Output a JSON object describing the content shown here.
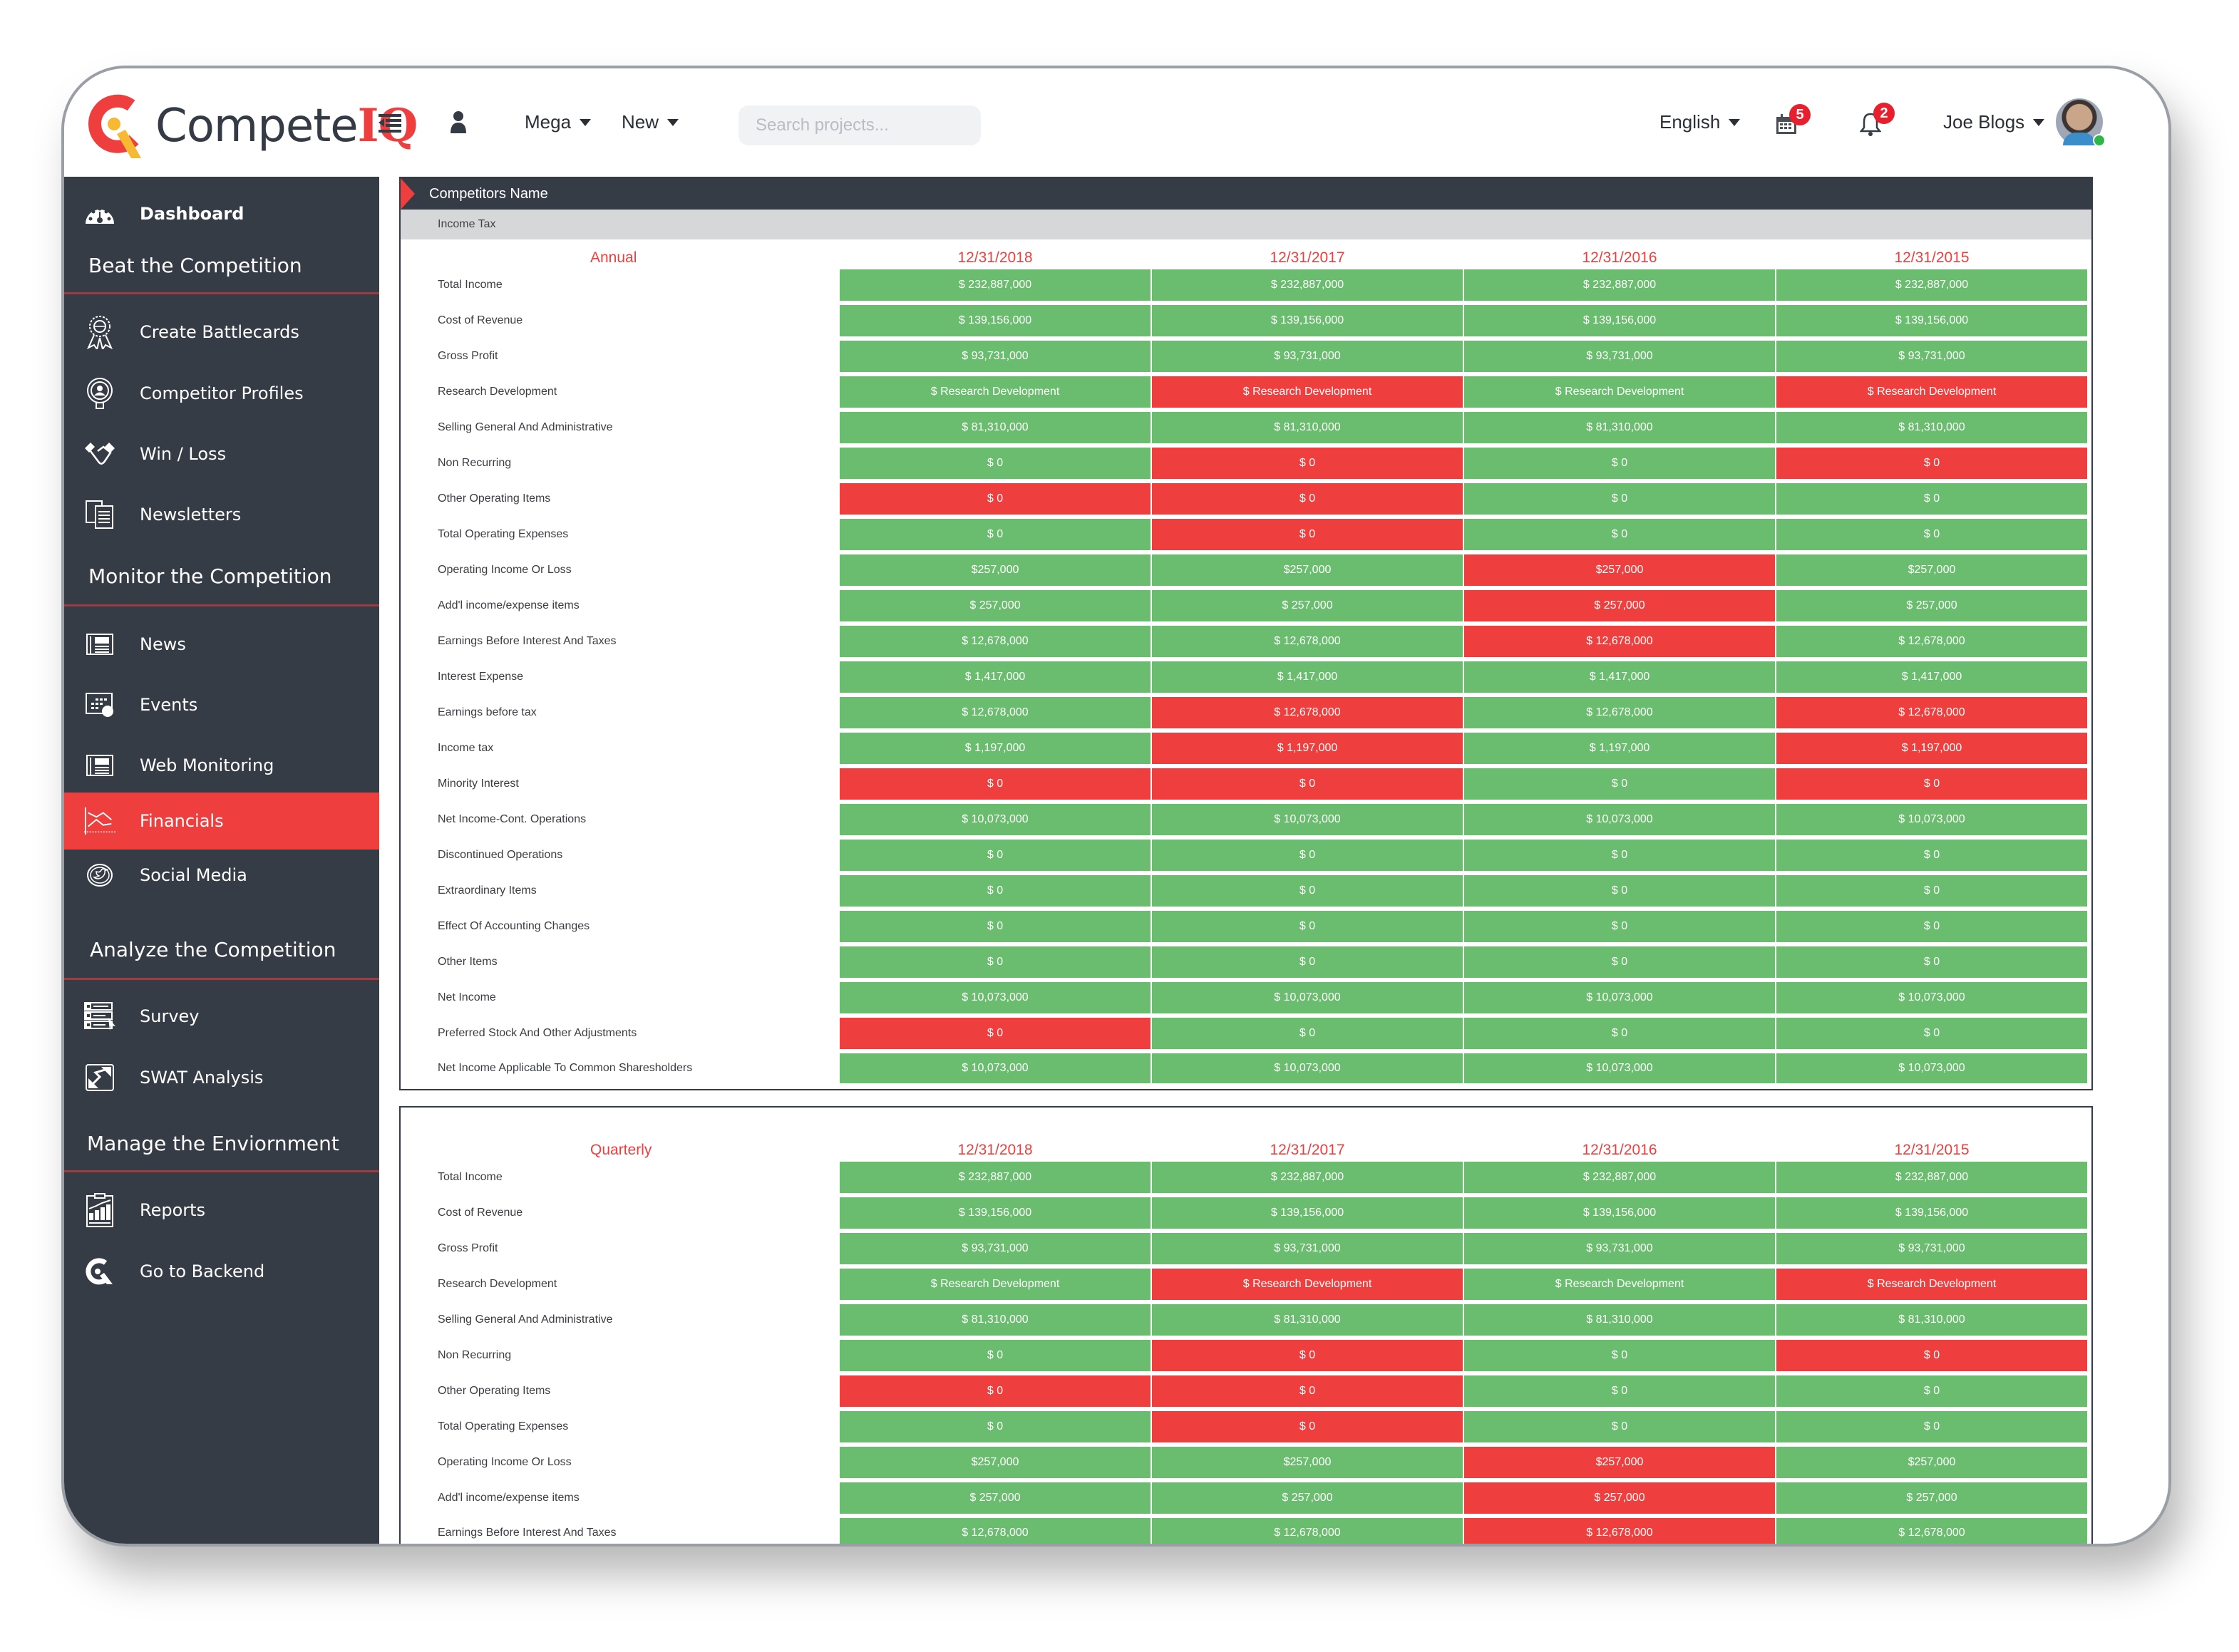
{
  "header": {
    "brand_prefix": "Compete",
    "brand_suffix": "IQ",
    "menus": [
      {
        "label": "Mega"
      },
      {
        "label": "New"
      }
    ],
    "search": {
      "placeholder": "Search projects...",
      "value": ""
    },
    "language": "English",
    "calendar_badge": "5",
    "notification_badge": "2",
    "user_name": "Joe Blogs",
    "user_status": "online"
  },
  "sidebar": {
    "dashboard": "Dashboard",
    "sections": [
      {
        "title": "Beat the Competition",
        "items": [
          {
            "label": "Create Battlecards",
            "icon": "award-ribbon-icon"
          },
          {
            "label": "Competitor Profiles",
            "icon": "profile-badge-icon"
          },
          {
            "label": "Win / Loss",
            "icon": "handshake-icon"
          },
          {
            "label": "Newsletters",
            "icon": "documents-icon"
          }
        ]
      },
      {
        "title": "Monitor the Competition",
        "items": [
          {
            "label": "News",
            "icon": "newspaper-icon"
          },
          {
            "label": "Events",
            "icon": "calendar-event-icon"
          },
          {
            "label": "Web Monitoring",
            "icon": "newspaper-icon"
          },
          {
            "label": "Financials",
            "icon": "chart-trend-icon",
            "active": true
          },
          {
            "label": "Social Media",
            "icon": "twitter-icon"
          }
        ]
      },
      {
        "title": "Analyze the Competition",
        "items": [
          {
            "label": "Survey",
            "icon": "survey-icon"
          },
          {
            "label": "SWAT Analysis",
            "icon": "swot-arrows-icon"
          }
        ]
      },
      {
        "title": "Manage the Enviornment",
        "items": [
          {
            "label": "Reports",
            "icon": "report-clipboard-icon"
          },
          {
            "label": "Go to Backend",
            "icon": "competeiq-logo-icon"
          }
        ]
      }
    ]
  },
  "colors": {
    "accent": "#ef3e3e",
    "positive": "#6abc6e",
    "negative": "#ef3e3e",
    "sidebar_bg": "#363c46"
  },
  "annual": {
    "card_title": "Competitors Name",
    "card_subtitle": "Income Tax",
    "period_label": "Annual",
    "columns": [
      "12/31/2018",
      "12/31/2017",
      "12/31/2016",
      "12/31/2015"
    ],
    "rows": [
      {
        "label": "Total Income",
        "values": [
          "$ 232,887,000",
          "$ 232,887,000",
          "$ 232,887,000",
          "$ 232,887,000"
        ],
        "status": [
          "g",
          "g",
          "g",
          "g"
        ]
      },
      {
        "label": "Cost of Revenue",
        "values": [
          "$ 139,156,000",
          "$ 139,156,000",
          "$ 139,156,000",
          "$ 139,156,000"
        ],
        "status": [
          "g",
          "g",
          "g",
          "g"
        ]
      },
      {
        "label": "Gross Profit",
        "values": [
          "$ 93,731,000",
          "$ 93,731,000",
          "$ 93,731,000",
          "$ 93,731,000"
        ],
        "status": [
          "g",
          "g",
          "g",
          "g"
        ]
      },
      {
        "label": "Research Development",
        "values": [
          "$ Research Development",
          "$ Research Development",
          "$ Research Development",
          "$ Research Development"
        ],
        "status": [
          "g",
          "r",
          "g",
          "r"
        ]
      },
      {
        "label": "Selling General And Administrative",
        "values": [
          "$ 81,310,000",
          "$ 81,310,000",
          "$ 81,310,000",
          "$ 81,310,000"
        ],
        "status": [
          "g",
          "g",
          "g",
          "g"
        ]
      },
      {
        "label": "Non Recurring",
        "values": [
          "$ 0",
          "$ 0",
          "$ 0",
          "$ 0"
        ],
        "status": [
          "g",
          "r",
          "g",
          "r"
        ]
      },
      {
        "label": "Other Operating Items",
        "values": [
          "$ 0",
          "$ 0",
          "$ 0",
          "$ 0"
        ],
        "status": [
          "r",
          "r",
          "g",
          "g"
        ]
      },
      {
        "label": "Total Operating Expenses",
        "values": [
          "$ 0",
          "$ 0",
          "$ 0",
          "$ 0"
        ],
        "status": [
          "g",
          "r",
          "g",
          "g"
        ]
      },
      {
        "label": "Operating Income Or Loss",
        "values": [
          "$257,000",
          "$257,000",
          "$257,000",
          "$257,000"
        ],
        "status": [
          "g",
          "g",
          "r",
          "g"
        ]
      },
      {
        "label": "Add'l income/expense items",
        "values": [
          "$ 257,000",
          "$ 257,000",
          "$ 257,000",
          "$ 257,000"
        ],
        "status": [
          "g",
          "g",
          "r",
          "g"
        ]
      },
      {
        "label": "Earnings Before Interest And Taxes",
        "values": [
          "$ 12,678,000",
          "$ 12,678,000",
          "$ 12,678,000",
          "$ 12,678,000"
        ],
        "status": [
          "g",
          "g",
          "r",
          "g"
        ]
      },
      {
        "label": "Interest Expense",
        "values": [
          "$ 1,417,000",
          "$ 1,417,000",
          "$ 1,417,000",
          "$ 1,417,000"
        ],
        "status": [
          "g",
          "g",
          "g",
          "g"
        ]
      },
      {
        "label": "Earnings before tax",
        "values": [
          "$ 12,678,000",
          "$ 12,678,000",
          "$ 12,678,000",
          "$ 12,678,000"
        ],
        "status": [
          "g",
          "r",
          "g",
          "r"
        ]
      },
      {
        "label": "Income tax",
        "values": [
          "$ 1,197,000",
          "$ 1,197,000",
          "$ 1,197,000",
          "$ 1,197,000"
        ],
        "status": [
          "g",
          "r",
          "g",
          "r"
        ]
      },
      {
        "label": "Minority Interest",
        "values": [
          "$ 0",
          "$ 0",
          "$ 0",
          "$ 0"
        ],
        "status": [
          "r",
          "r",
          "g",
          "r"
        ]
      },
      {
        "label": "Net Income-Cont. Operations",
        "values": [
          "$ 10,073,000",
          "$ 10,073,000",
          "$ 10,073,000",
          "$ 10,073,000"
        ],
        "status": [
          "g",
          "g",
          "g",
          "g"
        ]
      },
      {
        "label": "Discontinued Operations",
        "values": [
          "$ 0",
          "$ 0",
          "$ 0",
          "$ 0"
        ],
        "status": [
          "g",
          "g",
          "g",
          "g"
        ]
      },
      {
        "label": "Extraordinary Items",
        "values": [
          "$ 0",
          "$ 0",
          "$ 0",
          "$ 0"
        ],
        "status": [
          "g",
          "g",
          "g",
          "g"
        ]
      },
      {
        "label": "Effect Of Accounting Changes",
        "values": [
          "$ 0",
          "$ 0",
          "$ 0",
          "$ 0"
        ],
        "status": [
          "g",
          "g",
          "g",
          "g"
        ]
      },
      {
        "label": "Other Items",
        "values": [
          "$ 0",
          "$ 0",
          "$ 0",
          "$ 0"
        ],
        "status": [
          "g",
          "g",
          "g",
          "g"
        ]
      },
      {
        "label": "Net Income",
        "values": [
          "$ 10,073,000",
          "$ 10,073,000",
          "$ 10,073,000",
          "$ 10,073,000"
        ],
        "status": [
          "g",
          "g",
          "g",
          "g"
        ]
      },
      {
        "label": "Preferred Stock And Other Adjustments",
        "values": [
          "$ 0",
          "$ 0",
          "$ 0",
          "$ 0"
        ],
        "status": [
          "r",
          "g",
          "g",
          "g"
        ]
      },
      {
        "label": "Net Income Applicable To Common Sharesholders",
        "values": [
          "$ 10,073,000",
          "$ 10,073,000",
          "$ 10,073,000",
          "$ 10,073,000"
        ],
        "status": [
          "g",
          "g",
          "g",
          "g"
        ]
      }
    ]
  },
  "quarterly": {
    "period_label": "Quarterly",
    "columns": [
      "12/31/2018",
      "12/31/2017",
      "12/31/2016",
      "12/31/2015"
    ],
    "rows": [
      {
        "label": "Total Income",
        "values": [
          "$ 232,887,000",
          "$ 232,887,000",
          "$ 232,887,000",
          "$ 232,887,000"
        ],
        "status": [
          "g",
          "g",
          "g",
          "g"
        ]
      },
      {
        "label": "Cost of Revenue",
        "values": [
          "$ 139,156,000",
          "$ 139,156,000",
          "$ 139,156,000",
          "$ 139,156,000"
        ],
        "status": [
          "g",
          "g",
          "g",
          "g"
        ]
      },
      {
        "label": "Gross Profit",
        "values": [
          "$ 93,731,000",
          "$ 93,731,000",
          "$ 93,731,000",
          "$ 93,731,000"
        ],
        "status": [
          "g",
          "g",
          "g",
          "g"
        ]
      },
      {
        "label": "Research Development",
        "values": [
          "$ Research Development",
          "$ Research Development",
          "$ Research Development",
          "$ Research Development"
        ],
        "status": [
          "g",
          "r",
          "g",
          "r"
        ]
      },
      {
        "label": "Selling General And Administrative",
        "values": [
          "$ 81,310,000",
          "$ 81,310,000",
          "$ 81,310,000",
          "$ 81,310,000"
        ],
        "status": [
          "g",
          "g",
          "g",
          "g"
        ]
      },
      {
        "label": "Non Recurring",
        "values": [
          "$ 0",
          "$ 0",
          "$ 0",
          "$ 0"
        ],
        "status": [
          "g",
          "r",
          "g",
          "r"
        ]
      },
      {
        "label": "Other Operating Items",
        "values": [
          "$ 0",
          "$ 0",
          "$ 0",
          "$ 0"
        ],
        "status": [
          "r",
          "r",
          "g",
          "g"
        ]
      },
      {
        "label": "Total Operating Expenses",
        "values": [
          "$ 0",
          "$ 0",
          "$ 0",
          "$ 0"
        ],
        "status": [
          "g",
          "r",
          "g",
          "g"
        ]
      },
      {
        "label": "Operating Income Or Loss",
        "values": [
          "$257,000",
          "$257,000",
          "$257,000",
          "$257,000"
        ],
        "status": [
          "g",
          "g",
          "r",
          "g"
        ]
      },
      {
        "label": "Add'l income/expense items",
        "values": [
          "$ 257,000",
          "$ 257,000",
          "$ 257,000",
          "$ 257,000"
        ],
        "status": [
          "g",
          "g",
          "r",
          "g"
        ]
      },
      {
        "label": "Earnings Before Interest And Taxes",
        "values": [
          "$ 12,678,000",
          "$ 12,678,000",
          "$ 12,678,000",
          "$ 12,678,000"
        ],
        "status": [
          "g",
          "g",
          "r",
          "g"
        ]
      }
    ]
  }
}
